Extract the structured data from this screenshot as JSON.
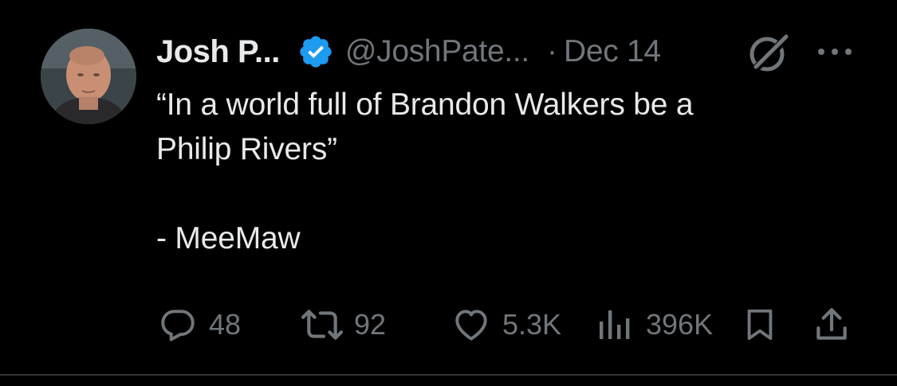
{
  "tweet": {
    "author_name": "Josh P...",
    "handle": "@JoshPate...",
    "separator": "·",
    "date": "Dec 14",
    "text": "“In a world full of Brandon Walkers be a\nPhilip Rivers”\n\n- MeeMaw",
    "verified_color": "#1d9bf0",
    "icons": {
      "verified": "verified-badge-icon",
      "grok": "grok-icon",
      "more": "more-options-icon"
    }
  },
  "actions": {
    "reply": {
      "icon": "reply-icon",
      "count": "48"
    },
    "retweet": {
      "icon": "retweet-icon",
      "count": "92"
    },
    "like": {
      "icon": "heart-icon",
      "count": "5.3K"
    },
    "views": {
      "icon": "views-chart-icon",
      "count": "396K"
    },
    "bookmark": {
      "icon": "bookmark-icon"
    },
    "share": {
      "icon": "share-icon"
    }
  },
  "colors": {
    "background": "#000000",
    "text_primary": "#e7e9ea",
    "text_secondary": "#71767b",
    "divider": "#2f3336"
  }
}
